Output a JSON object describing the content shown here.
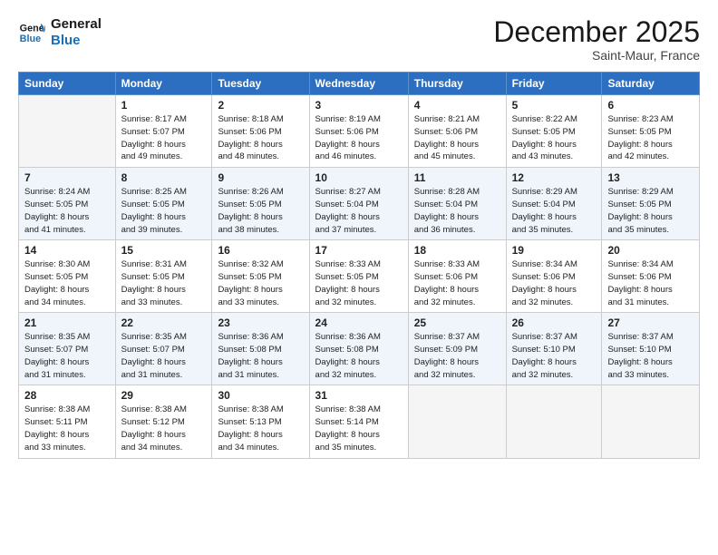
{
  "logo": {
    "line1": "General",
    "line2": "Blue"
  },
  "title": "December 2025",
  "location": "Saint-Maur, France",
  "days_of_week": [
    "Sunday",
    "Monday",
    "Tuesday",
    "Wednesday",
    "Thursday",
    "Friday",
    "Saturday"
  ],
  "weeks": [
    [
      {
        "num": "",
        "detail": ""
      },
      {
        "num": "1",
        "detail": "Sunrise: 8:17 AM\nSunset: 5:07 PM\nDaylight: 8 hours\nand 49 minutes."
      },
      {
        "num": "2",
        "detail": "Sunrise: 8:18 AM\nSunset: 5:06 PM\nDaylight: 8 hours\nand 48 minutes."
      },
      {
        "num": "3",
        "detail": "Sunrise: 8:19 AM\nSunset: 5:06 PM\nDaylight: 8 hours\nand 46 minutes."
      },
      {
        "num": "4",
        "detail": "Sunrise: 8:21 AM\nSunset: 5:06 PM\nDaylight: 8 hours\nand 45 minutes."
      },
      {
        "num": "5",
        "detail": "Sunrise: 8:22 AM\nSunset: 5:05 PM\nDaylight: 8 hours\nand 43 minutes."
      },
      {
        "num": "6",
        "detail": "Sunrise: 8:23 AM\nSunset: 5:05 PM\nDaylight: 8 hours\nand 42 minutes."
      }
    ],
    [
      {
        "num": "7",
        "detail": "Sunrise: 8:24 AM\nSunset: 5:05 PM\nDaylight: 8 hours\nand 41 minutes."
      },
      {
        "num": "8",
        "detail": "Sunrise: 8:25 AM\nSunset: 5:05 PM\nDaylight: 8 hours\nand 39 minutes."
      },
      {
        "num": "9",
        "detail": "Sunrise: 8:26 AM\nSunset: 5:05 PM\nDaylight: 8 hours\nand 38 minutes."
      },
      {
        "num": "10",
        "detail": "Sunrise: 8:27 AM\nSunset: 5:04 PM\nDaylight: 8 hours\nand 37 minutes."
      },
      {
        "num": "11",
        "detail": "Sunrise: 8:28 AM\nSunset: 5:04 PM\nDaylight: 8 hours\nand 36 minutes."
      },
      {
        "num": "12",
        "detail": "Sunrise: 8:29 AM\nSunset: 5:04 PM\nDaylight: 8 hours\nand 35 minutes."
      },
      {
        "num": "13",
        "detail": "Sunrise: 8:29 AM\nSunset: 5:05 PM\nDaylight: 8 hours\nand 35 minutes."
      }
    ],
    [
      {
        "num": "14",
        "detail": "Sunrise: 8:30 AM\nSunset: 5:05 PM\nDaylight: 8 hours\nand 34 minutes."
      },
      {
        "num": "15",
        "detail": "Sunrise: 8:31 AM\nSunset: 5:05 PM\nDaylight: 8 hours\nand 33 minutes."
      },
      {
        "num": "16",
        "detail": "Sunrise: 8:32 AM\nSunset: 5:05 PM\nDaylight: 8 hours\nand 33 minutes."
      },
      {
        "num": "17",
        "detail": "Sunrise: 8:33 AM\nSunset: 5:05 PM\nDaylight: 8 hours\nand 32 minutes."
      },
      {
        "num": "18",
        "detail": "Sunrise: 8:33 AM\nSunset: 5:06 PM\nDaylight: 8 hours\nand 32 minutes."
      },
      {
        "num": "19",
        "detail": "Sunrise: 8:34 AM\nSunset: 5:06 PM\nDaylight: 8 hours\nand 32 minutes."
      },
      {
        "num": "20",
        "detail": "Sunrise: 8:34 AM\nSunset: 5:06 PM\nDaylight: 8 hours\nand 31 minutes."
      }
    ],
    [
      {
        "num": "21",
        "detail": "Sunrise: 8:35 AM\nSunset: 5:07 PM\nDaylight: 8 hours\nand 31 minutes."
      },
      {
        "num": "22",
        "detail": "Sunrise: 8:35 AM\nSunset: 5:07 PM\nDaylight: 8 hours\nand 31 minutes."
      },
      {
        "num": "23",
        "detail": "Sunrise: 8:36 AM\nSunset: 5:08 PM\nDaylight: 8 hours\nand 31 minutes."
      },
      {
        "num": "24",
        "detail": "Sunrise: 8:36 AM\nSunset: 5:08 PM\nDaylight: 8 hours\nand 32 minutes."
      },
      {
        "num": "25",
        "detail": "Sunrise: 8:37 AM\nSunset: 5:09 PM\nDaylight: 8 hours\nand 32 minutes."
      },
      {
        "num": "26",
        "detail": "Sunrise: 8:37 AM\nSunset: 5:10 PM\nDaylight: 8 hours\nand 32 minutes."
      },
      {
        "num": "27",
        "detail": "Sunrise: 8:37 AM\nSunset: 5:10 PM\nDaylight: 8 hours\nand 33 minutes."
      }
    ],
    [
      {
        "num": "28",
        "detail": "Sunrise: 8:38 AM\nSunset: 5:11 PM\nDaylight: 8 hours\nand 33 minutes."
      },
      {
        "num": "29",
        "detail": "Sunrise: 8:38 AM\nSunset: 5:12 PM\nDaylight: 8 hours\nand 34 minutes."
      },
      {
        "num": "30",
        "detail": "Sunrise: 8:38 AM\nSunset: 5:13 PM\nDaylight: 8 hours\nand 34 minutes."
      },
      {
        "num": "31",
        "detail": "Sunrise: 8:38 AM\nSunset: 5:14 PM\nDaylight: 8 hours\nand 35 minutes."
      },
      {
        "num": "",
        "detail": ""
      },
      {
        "num": "",
        "detail": ""
      },
      {
        "num": "",
        "detail": ""
      }
    ]
  ]
}
